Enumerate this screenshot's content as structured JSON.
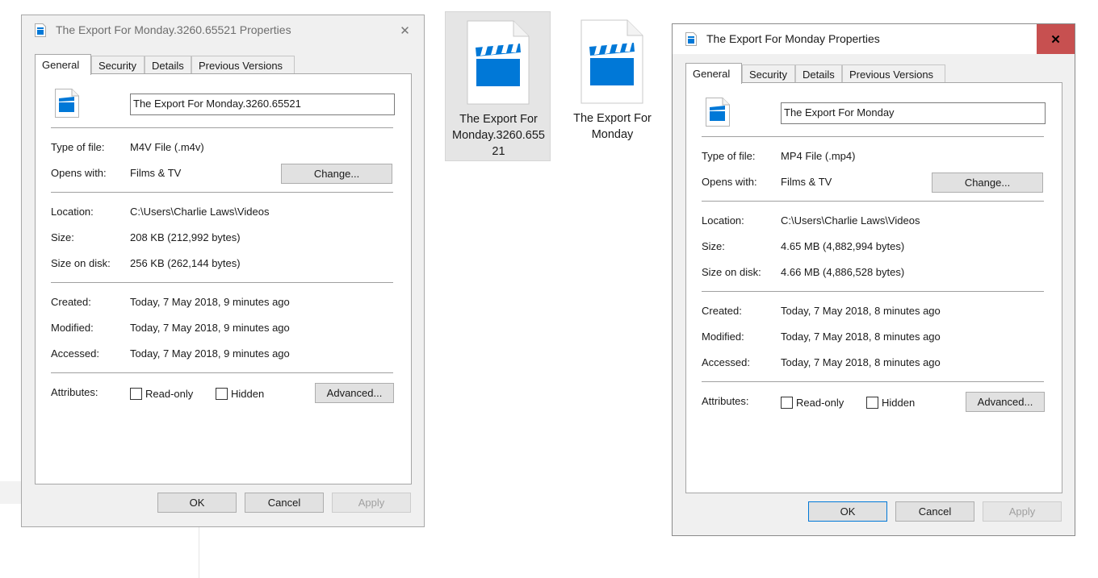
{
  "colors": {
    "accent": "#0078d7",
    "close_red": "#c75050"
  },
  "desktop": {
    "items": [
      {
        "name_line1": "The Export For",
        "name_line2": "Monday.3260.655",
        "name_line3": "21",
        "icon": "video-file-icon",
        "selected": true
      },
      {
        "name_line1": "The Export For",
        "name_line2": "Monday",
        "icon": "video-file-icon",
        "selected": false
      }
    ]
  },
  "dialog1": {
    "title": "The Export For Monday.3260.65521 Properties",
    "close_glyph": "✕",
    "tabs": [
      "General",
      "Security",
      "Details",
      "Previous Versions"
    ],
    "file_name": "The Export For Monday.3260.65521",
    "type_label": "Type of file:",
    "type_value": "M4V File (.m4v)",
    "opens_label": "Opens with:",
    "opens_value": "Films & TV",
    "change_button": "Change...",
    "location_label": "Location:",
    "location_value": "C:\\Users\\Charlie Laws\\Videos",
    "size_label": "Size:",
    "size_value": "208 KB (212,992 bytes)",
    "disk_label": "Size on disk:",
    "disk_value": "256 KB (262,144 bytes)",
    "created_label": "Created:",
    "created_value": "Today, 7 May 2018, 9 minutes ago",
    "modified_label": "Modified:",
    "modified_value": "Today, 7 May 2018, 9 minutes ago",
    "accessed_label": "Accessed:",
    "accessed_value": "Today, 7 May 2018, 9 minutes ago",
    "attributes_label": "Attributes:",
    "readonly_label": "Read-only",
    "hidden_label": "Hidden",
    "advanced_button": "Advanced...",
    "ok_button": "OK",
    "cancel_button": "Cancel",
    "apply_button": "Apply"
  },
  "dialog2": {
    "title": "The Export For Monday Properties",
    "close_glyph": "✕",
    "tabs": [
      "General",
      "Security",
      "Details",
      "Previous Versions"
    ],
    "file_name": "The Export For Monday",
    "type_label": "Type of file:",
    "type_value": "MP4 File (.mp4)",
    "opens_label": "Opens with:",
    "opens_value": "Films & TV",
    "change_button": "Change...",
    "location_label": "Location:",
    "location_value": "C:\\Users\\Charlie Laws\\Videos",
    "size_label": "Size:",
    "size_value": "4.65 MB (4,882,994 bytes)",
    "disk_label": "Size on disk:",
    "disk_value": "4.66 MB (4,886,528 bytes)",
    "created_label": "Created:",
    "created_value": "Today, 7 May 2018, 8 minutes ago",
    "modified_label": "Modified:",
    "modified_value": "Today, 7 May 2018, 8 minutes ago",
    "accessed_label": "Accessed:",
    "accessed_value": "Today, 7 May 2018, 8 minutes ago",
    "attributes_label": "Attributes:",
    "readonly_label": "Read-only",
    "hidden_label": "Hidden",
    "advanced_button": "Advanced...",
    "ok_button": "OK",
    "cancel_button": "Cancel",
    "apply_button": "Apply"
  }
}
